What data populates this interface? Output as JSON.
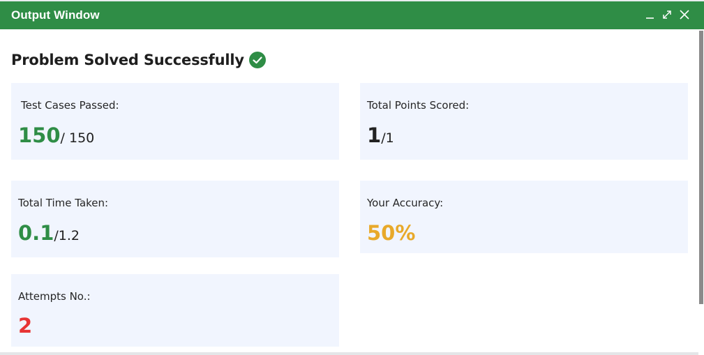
{
  "window": {
    "title": "Output Window",
    "controls": {
      "minimize_icon": "minimize-icon",
      "maximize_icon": "expand-icon",
      "close_icon": "close-icon"
    }
  },
  "result": {
    "heading": "Problem Solved Successfully",
    "status_icon": "check-circle-icon"
  },
  "stats": {
    "test_cases": {
      "label": "Test Cases Passed:",
      "value": "150",
      "total": " / 150"
    },
    "points": {
      "label": "Total Points Scored:",
      "value": "1",
      "total": "/1"
    },
    "time": {
      "label": "Total Time Taken:",
      "value": "0.1",
      "total": "/1.2"
    },
    "accuracy": {
      "label": "Your Accuracy:",
      "value": "50%"
    },
    "attempts": {
      "label": "Attempts No.:",
      "value": "2"
    }
  },
  "colors": {
    "titlebar": "#2f8d46",
    "success_green": "#2f8d46",
    "accuracy_amber": "#e8a92a",
    "attempts_red": "#e73434",
    "card_background": "#f1f5fe",
    "value_dark": "#222222"
  }
}
